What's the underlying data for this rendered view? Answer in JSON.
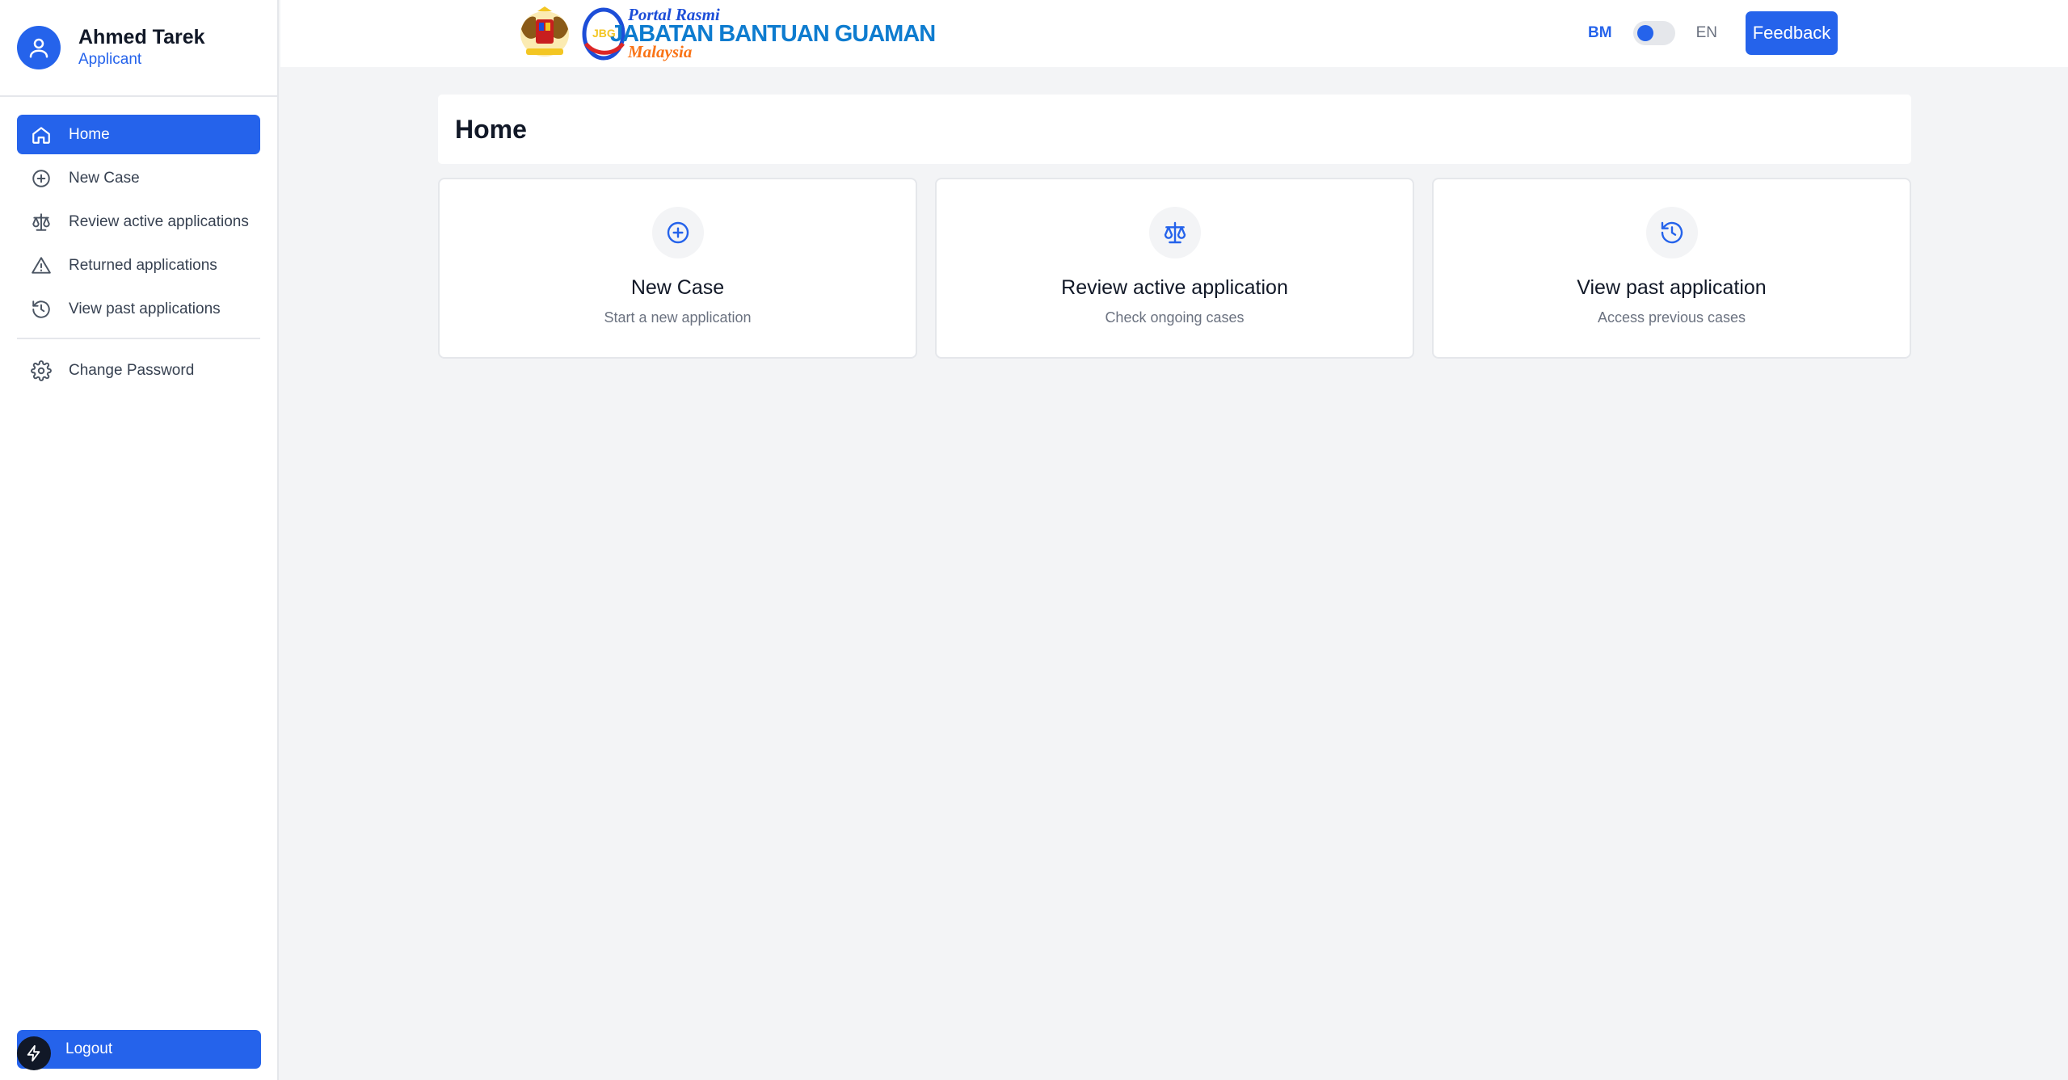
{
  "user": {
    "name": "Ahmed Tarek",
    "role": "Applicant"
  },
  "sidebar": {
    "items": [
      {
        "label": "Home",
        "icon": "home-icon",
        "active": true
      },
      {
        "label": "New Case",
        "icon": "plus-circle-icon"
      },
      {
        "label": "Review active applications",
        "icon": "scale-icon"
      },
      {
        "label": "Returned applications",
        "icon": "warning-icon"
      },
      {
        "label": "View past applications",
        "icon": "history-icon"
      }
    ],
    "secondary": [
      {
        "label": "Change Password",
        "icon": "gear-icon"
      }
    ],
    "logout_label": "Logout"
  },
  "header": {
    "logo": {
      "line1": "Portal Rasmi",
      "line2": "JABATAN BANTUAN GUAMAN",
      "line3": "Malaysia"
    },
    "lang_bm": "BM",
    "lang_en": "EN",
    "feedback_label": "Feedback"
  },
  "main": {
    "title": "Home",
    "cards": [
      {
        "title": "New Case",
        "subtitle": "Start a new application",
        "icon": "plus-circle-icon"
      },
      {
        "title": "Review active application",
        "subtitle": "Check ongoing cases",
        "icon": "scale-icon"
      },
      {
        "title": "View past application",
        "subtitle": "Access previous cases",
        "icon": "history-icon"
      }
    ]
  },
  "colors": {
    "primary": "#2563eb",
    "background": "#f3f4f6",
    "surface": "#ffffff",
    "accent_logo": "#f97316"
  }
}
